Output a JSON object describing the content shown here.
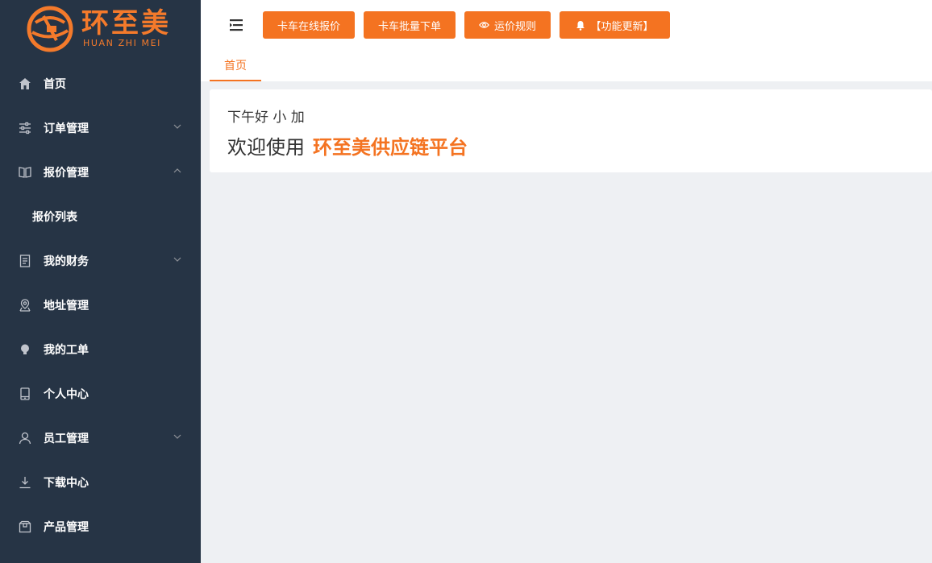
{
  "app": {
    "logo_title": "环至美",
    "logo_subtitle": "HUAN ZHI MEI"
  },
  "sidebar": {
    "items": [
      {
        "label": "首页",
        "icon": "home-icon",
        "has_arrow": false
      },
      {
        "label": "订单管理",
        "icon": "sliders-icon",
        "has_arrow": true,
        "expanded": false
      },
      {
        "label": "报价管理",
        "icon": "book-icon",
        "has_arrow": true,
        "expanded": true
      },
      {
        "label": "报价列表",
        "icon": "",
        "sub": true
      },
      {
        "label": "我的财务",
        "icon": "document-icon",
        "has_arrow": true,
        "expanded": false
      },
      {
        "label": "地址管理",
        "icon": "location-pin-icon",
        "has_arrow": false
      },
      {
        "label": "我的工单",
        "icon": "bulb-icon",
        "has_arrow": false
      },
      {
        "label": "个人中心",
        "icon": "mobile-icon",
        "has_arrow": false
      },
      {
        "label": "员工管理",
        "icon": "user-icon",
        "has_arrow": true,
        "expanded": false
      },
      {
        "label": "下载中心",
        "icon": "download-icon",
        "has_arrow": false
      },
      {
        "label": "产品管理",
        "icon": "box-icon",
        "has_arrow": false
      }
    ]
  },
  "toolbar": {
    "buttons": [
      {
        "label": "卡车在线报价",
        "icon": ""
      },
      {
        "label": "卡车批量下单",
        "icon": ""
      },
      {
        "label": "运价规则",
        "icon": "eye-icon"
      },
      {
        "label": "【功能更新】",
        "icon": "bell-icon"
      }
    ]
  },
  "tabs": [
    {
      "label": "首页",
      "active": true
    }
  ],
  "welcome": {
    "greeting": "下午好 小 加",
    "prefix": "欢迎使用",
    "brand": "环至美供应链平台"
  },
  "colors": {
    "accent": "#f47321",
    "sidebar_bg": "#263445",
    "content_bg": "#eef0f3"
  }
}
